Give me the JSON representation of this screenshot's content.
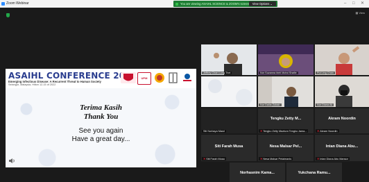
{
  "window": {
    "title": "Zoom Webinar"
  },
  "share_bar": {
    "status": "You are viewing ASAIHL SCIENCE & ZOOM's screen",
    "view_options": "View Options ⌄"
  },
  "toolbar": {
    "view_label": "View"
  },
  "slide": {
    "conference_title": "ASAIHL CONFERENCE 2022",
    "subtitle": "Emerging Infectious Disease: A Recurrent Threat to Human Society",
    "location": "Selangor, Malaysia, Hilton 12-15 of 2022",
    "logos": [
      "UPM",
      "UPM",
      "MJ",
      "Malaysia"
    ],
    "thanks_line1": "Terima Kasih",
    "thanks_line2": "Thank You",
    "see_you_line1": "See you again",
    "see_you_line2": "Have a great day..."
  },
  "participants": [
    {
      "name": "Jeffrey Chan Lung Thei",
      "muted": false,
      "video": true
    },
    {
      "name": "Nor Suzanna binti Mohd Shafie",
      "muted": false,
      "video": true
    },
    {
      "name": "Pui Ling Chan",
      "muted": false,
      "video": true
    },
    {
      "name": "Siti Norbaya Masri",
      "muted": false,
      "video": false
    },
    {
      "name": "Nur Dalila Zubair",
      "muted": false,
      "video": true
    },
    {
      "name": "Nur Diana Ali",
      "muted": false,
      "video": true
    },
    {
      "name": "Siti Norbaya Masri",
      "muted": false,
      "video": false,
      "big": ""
    },
    {
      "name": "Tengku Zetty Maztura Tengku Jama...",
      "big": "Tengku Zetty M...",
      "muted": true,
      "video": false
    },
    {
      "name": "Akram Noordin",
      "big": "Akram Noordin",
      "muted": true,
      "video": false
    },
    {
      "name": "Siti Farah Musa",
      "big": "Siti Farah Musa",
      "muted": true,
      "video": false
    },
    {
      "name": "Nesa Malsar Pelaimanis",
      "big": "Nesa Malsar Pel...",
      "muted": true,
      "video": false
    },
    {
      "name": "Intan Diana Abu Mansor",
      "big": "Intan Diana Abu...",
      "muted": true,
      "video": false
    },
    {
      "name": "Norhasnim Kama...",
      "big": "Norhasnim Kama...",
      "muted": true,
      "video": false
    },
    {
      "name": "Yukchana Ramu...",
      "big": "Yukchana Ramu...",
      "muted": true,
      "video": false
    }
  ],
  "colors": {
    "zoom_blue": "#2d8cff",
    "share_green": "#1d7d33",
    "mute_red": "#e23"
  }
}
